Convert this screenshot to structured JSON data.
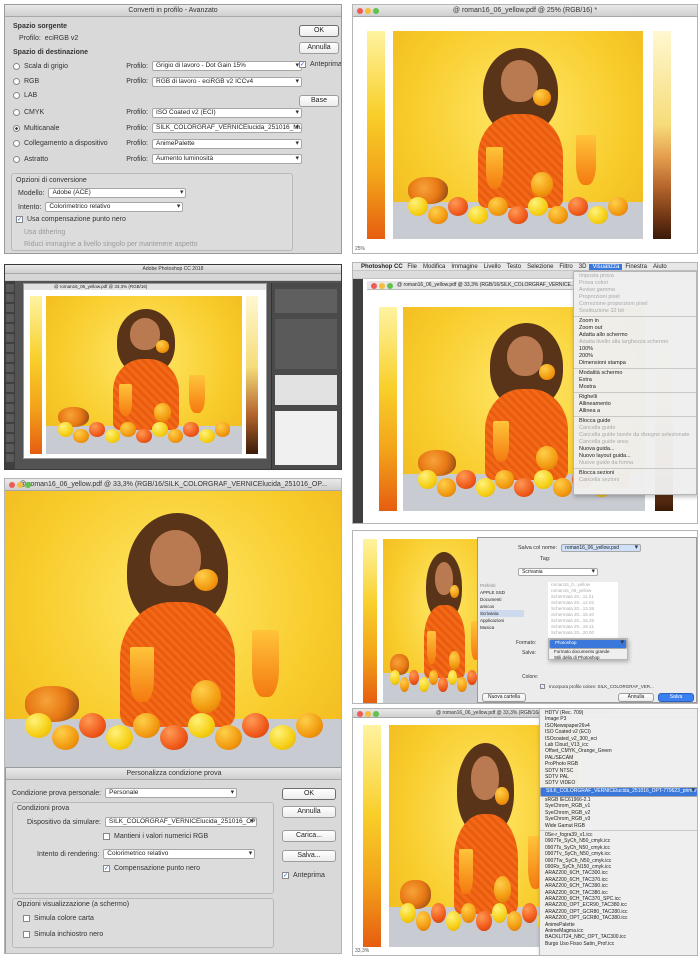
{
  "p1": {
    "title": "Converti in profilo - Avanzato",
    "source_heading": "Spazio sorgente",
    "source_profile_label": "Profilo:",
    "source_profile": "eciRGB v2",
    "dest_heading": "Spazio di destinazione",
    "rows": [
      {
        "name": "Scala di grigio",
        "profile_label": "Profilo:",
        "value": "Grigio di lavoro - Dot Gain 15%",
        "on": false
      },
      {
        "name": "RGB",
        "profile_label": "Profilo:",
        "value": "RGB di lavoro - eciRGB v2 ICCv4",
        "on": false
      },
      {
        "name": "LAB",
        "profile_label": "",
        "value": "",
        "on": false
      },
      {
        "name": "CMYK",
        "profile_label": "Profilo:",
        "value": "ISO Coated v2 (ECI)",
        "on": false
      },
      {
        "name": "Multicanale",
        "profile_label": "Profilo:",
        "value": "SILK_COLORGRAF_VERNICElucida_251016_MultiCol...",
        "on": true
      },
      {
        "name": "Collegamento a dispositivo",
        "profile_label": "Profilo:",
        "value": "AnimePalette",
        "on": false
      },
      {
        "name": "Astratto",
        "profile_label": "Profilo:",
        "value": "Aumento luminosità",
        "on": false
      }
    ],
    "options_heading": "Opzioni di conversione",
    "model_label": "Modello:",
    "model_value": "Adobe (ACE)",
    "intent_label": "Intento:",
    "intent_value": "Colorimetrico relativo",
    "bpc": "Usa compensazione punto nero",
    "dither": "Usa dithering",
    "flatten": "Riduci immagine a livello singolo per mantenere aspetto",
    "ok": "OK",
    "cancel": "Annulla",
    "preview": "Anteprima",
    "basic": "Base"
  },
  "p2": {
    "title": "@ roman16_06_yellow.pdf @ 25% (RGB/16) *",
    "zoom": "25%"
  },
  "p3": {
    "title": "Adobe Photoshop CC 2018",
    "doc": "@ roman16_06_yellow.pdf @ 33,3% (RGB/16)"
  },
  "p4": {
    "app": "Photoshop CC",
    "menus": [
      "File",
      "Modifica",
      "Immagine",
      "Livello",
      "Testo",
      "Selezione",
      "Filtro",
      "3D",
      "Visualizza",
      "Finestra",
      "Aiuto"
    ],
    "doc": "@ roman16_06_yellow.pdf @ 33,3% (RGB/16/SILK_COLORGRAF_VERNICE...",
    "menu_items": [
      {
        "t": "Imposta prova",
        "d": true
      },
      {
        "t": "Prova colori",
        "d": true
      },
      {
        "t": "Avviso gamma",
        "d": true
      },
      {
        "t": "Proporzioni pixel",
        "d": true
      },
      {
        "t": "Correzione proporzioni pixel",
        "d": true
      },
      {
        "t": "Sostituzione 32 bit",
        "d": true
      },
      {
        "t": "Zoom in",
        "d": false
      },
      {
        "t": "Zoom out",
        "d": false
      },
      {
        "t": "Adatta allo schermo",
        "d": false
      },
      {
        "t": "Adatta livello alla larghezza schermo",
        "d": true
      },
      {
        "t": "100%",
        "d": false
      },
      {
        "t": "200%",
        "d": false
      },
      {
        "t": "Dimensioni stampa",
        "d": false
      },
      {
        "t": "Modalità schermo",
        "d": false
      },
      {
        "t": "Extra",
        "d": false
      },
      {
        "t": "Mostra",
        "d": false
      },
      {
        "t": "Righelli",
        "d": false
      },
      {
        "t": "Allineamento",
        "d": false
      },
      {
        "t": "Allinea a",
        "d": false
      },
      {
        "t": "Blocca guide",
        "d": false
      },
      {
        "t": "Cancella guide",
        "d": true
      },
      {
        "t": "Cancella guide tavole da disegno selezionate",
        "d": true
      },
      {
        "t": "Cancella guide area",
        "d": true
      },
      {
        "t": "Nuova guida...",
        "d": false
      },
      {
        "t": "Nuovo layout guida...",
        "d": false
      },
      {
        "t": "Nuove guide da forma",
        "d": true
      },
      {
        "t": "Blocca sezioni",
        "d": false
      },
      {
        "t": "Cancella sezioni",
        "d": true
      }
    ]
  },
  "p5": {
    "doc": "@ roman16_06_yellow.pdf @ 33,3% (RGB/16/SILK_COLORGRAF_VERNICElucida_251016_OP...",
    "dialog_title": "Personalizza condizione prova",
    "custom_label": "Condizione prova personale:",
    "custom_value": "Personale",
    "cond_heading": "Condizioni prova",
    "device_label": "Dispositivo da simulare:",
    "device_value": "SILK_COLORGRAF_VERNICElucida_251016_OPT-779...",
    "keep_rgb": "Mantieni i valori numerici RGB",
    "intent_label": "Intento di rendering:",
    "intent_value": "Colorimetrico relativo",
    "bpc": "Compensazione punto nero",
    "display_heading": "Opzioni visualizzazione (a schermo)",
    "paper": "Simula colore carta",
    "ink": "Simula inchiostro nero",
    "ok": "OK",
    "cancel": "Annulla",
    "load": "Carica...",
    "save": "Salva...",
    "preview": "Anteprima"
  },
  "p6": {
    "save_as_label": "Salva col nome:",
    "save_as_value": "roman16_06_yellow.psd",
    "tags_label": "Tag:",
    "location": "Scrivania",
    "sidebar": [
      "Preferiti",
      "APPLE SSD",
      "Documenti",
      "amicos",
      "Scrivania",
      "Applicazioni",
      "Musica"
    ],
    "files": [
      "roman16_0...yellow",
      "roman16_06_yellow",
      "Schermata 20...11.21",
      "Schermata 20...12.02",
      "Schermata 20...13.38",
      "Schermata 20...15.40",
      "Schermata 20...16.25",
      "Schermata 20...18.11",
      "Schermata 20...20.00"
    ],
    "format_label": "Formato:",
    "formats": [
      "Photoshop",
      "Formato documento grande",
      "Stili della di Photoshop"
    ],
    "save_label": "Salva:",
    "color_label": "Colore:",
    "embed": "Incorpora profilo colore:  SILK_COLORGRAF_VER...",
    "new_folder": "Nuova cartella",
    "cancel": "Annulla",
    "save": "Salva"
  },
  "p7": {
    "doc": "@ roman16_06_yellow.pdf @ 33,3% (RGB/16/SILK_COLORGRAF_VERNICE...",
    "zoom": "33,3%",
    "profiles": [
      {
        "t": "HDTV (Rec. 709)",
        "s": false
      },
      {
        "t": "Image P3",
        "s": false
      },
      {
        "t": "ISONewspaper26v4",
        "s": false
      },
      {
        "t": "ISO Coated v2 (ECI)",
        "s": false
      },
      {
        "t": "ISOcoated_v2_300_eci",
        "s": false
      },
      {
        "t": "Lab Cloud_V13_icc",
        "s": false
      },
      {
        "t": "Offset_CMYK_Orange_Green",
        "s": false
      },
      {
        "t": "PAL/SECAM",
        "s": false
      },
      {
        "t": "ProPhoto RGB",
        "s": false
      },
      {
        "t": "SDTV NTSC",
        "s": false
      },
      {
        "t": "SDTV PAL",
        "s": false
      },
      {
        "t": "SDTV VIDEO",
        "s": false
      },
      {
        "t": "SILK_COLORGRAF_VERNICElucida_251016_OPT-779623_primera.icc",
        "s": true
      },
      {
        "t": "sRGB IEC61966-2.1",
        "s": false
      },
      {
        "t": "SyeChrom_RGB_v1",
        "s": false
      },
      {
        "t": "SyeChrom_RGB_v2",
        "s": false
      },
      {
        "t": "SyeChrom_RGB_v3",
        "s": false
      },
      {
        "t": "Wide Gamut RGB",
        "s": false
      },
      {
        "t": "0Se-r_fogra39_v1.icc",
        "s": false
      },
      {
        "t": "0907Te_SyCh_N50_cmyk.icc",
        "s": false
      },
      {
        "t": "0907Ts_SyCh_N50_cmyk.icc",
        "s": false
      },
      {
        "t": "0907Tv_SyCh_N50_cmyk.icc",
        "s": false
      },
      {
        "t": "0907Tw_SyCh_N50_cmyk.icc",
        "s": false
      },
      {
        "t": "090Rx_SyCh_N150_cmyk.icc",
        "s": false
      },
      {
        "t": "ARAZ200_6CH_TAC300.icc",
        "s": false
      },
      {
        "t": "ARAZ200_6CH_TAC370.icc",
        "s": false
      },
      {
        "t": "ARAZ200_6CH_TAC390.icc",
        "s": false
      },
      {
        "t": "ARAZ200_6CH_TAC380.icc",
        "s": false
      },
      {
        "t": "ARAZ200_6CH_TAC370_SPC.icc",
        "s": false
      },
      {
        "t": "ARAZ200_OPT_ECR90_TAC380.icc",
        "s": false
      },
      {
        "t": "ARAZ200_OPT_GCR80_TAC280.icc",
        "s": false
      },
      {
        "t": "ARAZ200_OPT_GCR80_TAC380.icc",
        "s": false
      },
      {
        "t": "AnimePalette",
        "s": false
      },
      {
        "t": "AnimeMagma.icc",
        "s": false
      },
      {
        "t": "BACKLIT24_NBC_OPT_TAC300.icc",
        "s": false
      },
      {
        "t": "Burgo Uso Fisso Satin_Prof.icc",
        "s": false
      }
    ]
  }
}
